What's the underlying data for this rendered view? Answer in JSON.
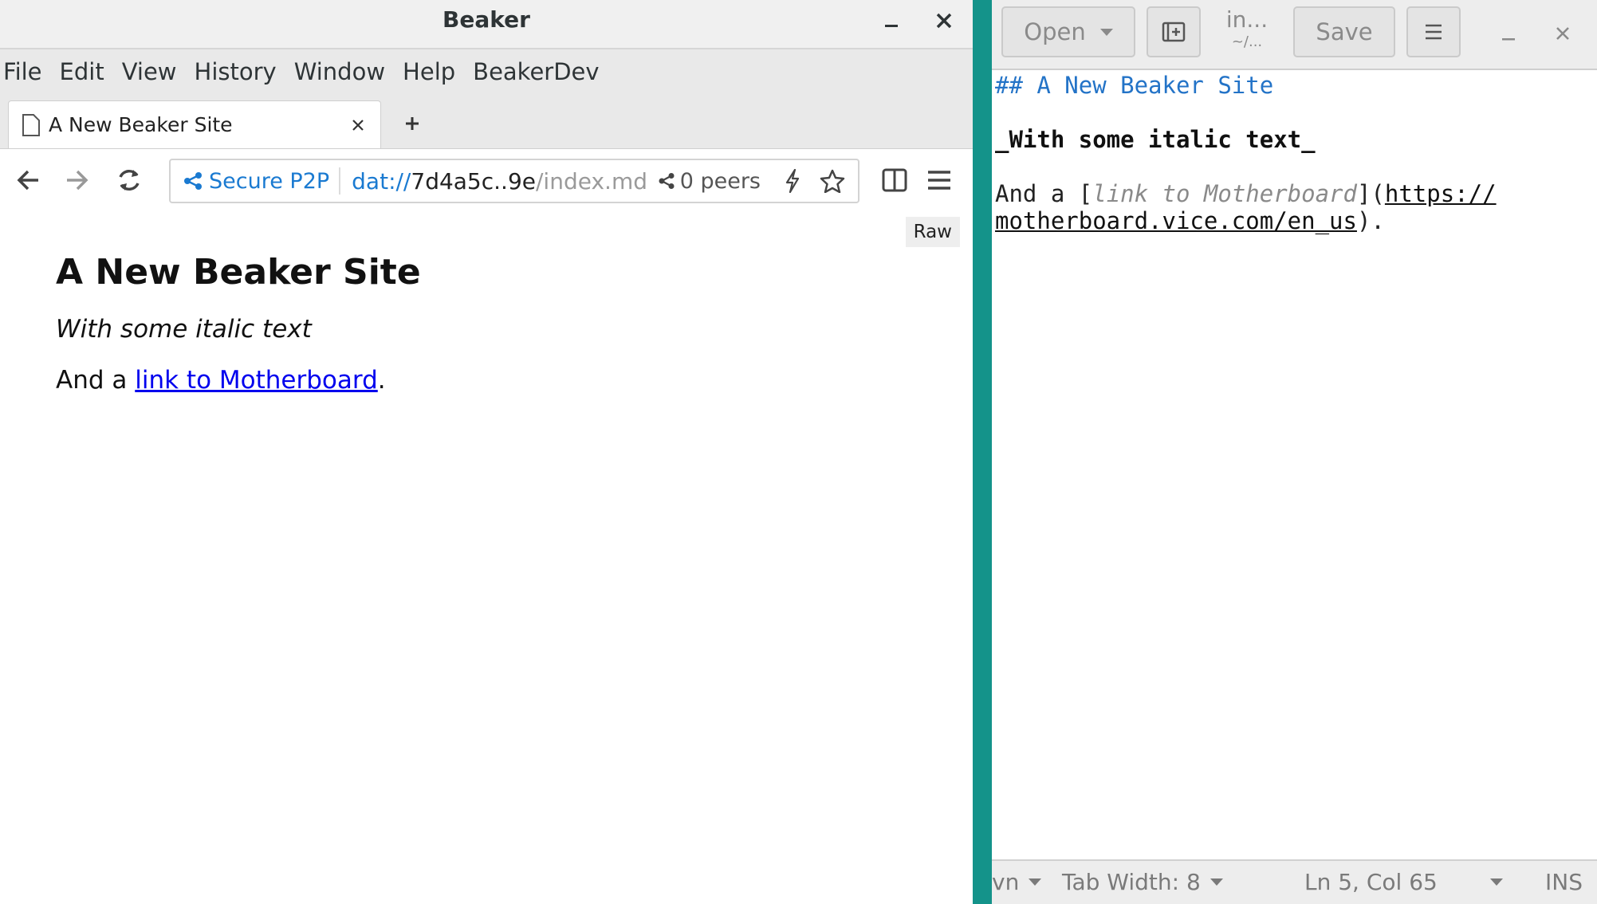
{
  "browser": {
    "title": "Beaker",
    "menu": [
      "File",
      "Edit",
      "View",
      "History",
      "Window",
      "Help",
      "BeakerDev"
    ],
    "tab": {
      "label": "A New Beaker Site"
    },
    "url": {
      "secure": "Secure P2P",
      "proto": "dat://",
      "host": "7d4a5c..9e",
      "path": "/index.md",
      "peers": "0 peers"
    },
    "raw_button": "Raw",
    "page": {
      "heading": "A New Beaker Site",
      "italic": "With some italic text",
      "para_prefix": "And a ",
      "link_text": "link to Motherboard",
      "para_suffix": "."
    }
  },
  "editor": {
    "open_label": "Open",
    "save_label": "Save",
    "title": "in...",
    "subtitle": "~/...",
    "lines": {
      "l1": "## A New Beaker Site",
      "l3": "_With some italic text_",
      "l5a": "And a ",
      "l5b": "[",
      "l5c": "link to Motherboard",
      "l5d": "](",
      "l5e": "https://",
      "l6a": "motherboard.vice.com/en_us",
      "l6b": ")."
    },
    "status": {
      "lang": "vn",
      "tab_width": "Tab Width: 8",
      "position": "Ln 5, Col 65",
      "mode": "INS"
    }
  },
  "colors": {
    "accent": "#1a7ad1",
    "link": "#0000ee",
    "desktop": "#11968a",
    "md_heading": "#2373c7"
  }
}
